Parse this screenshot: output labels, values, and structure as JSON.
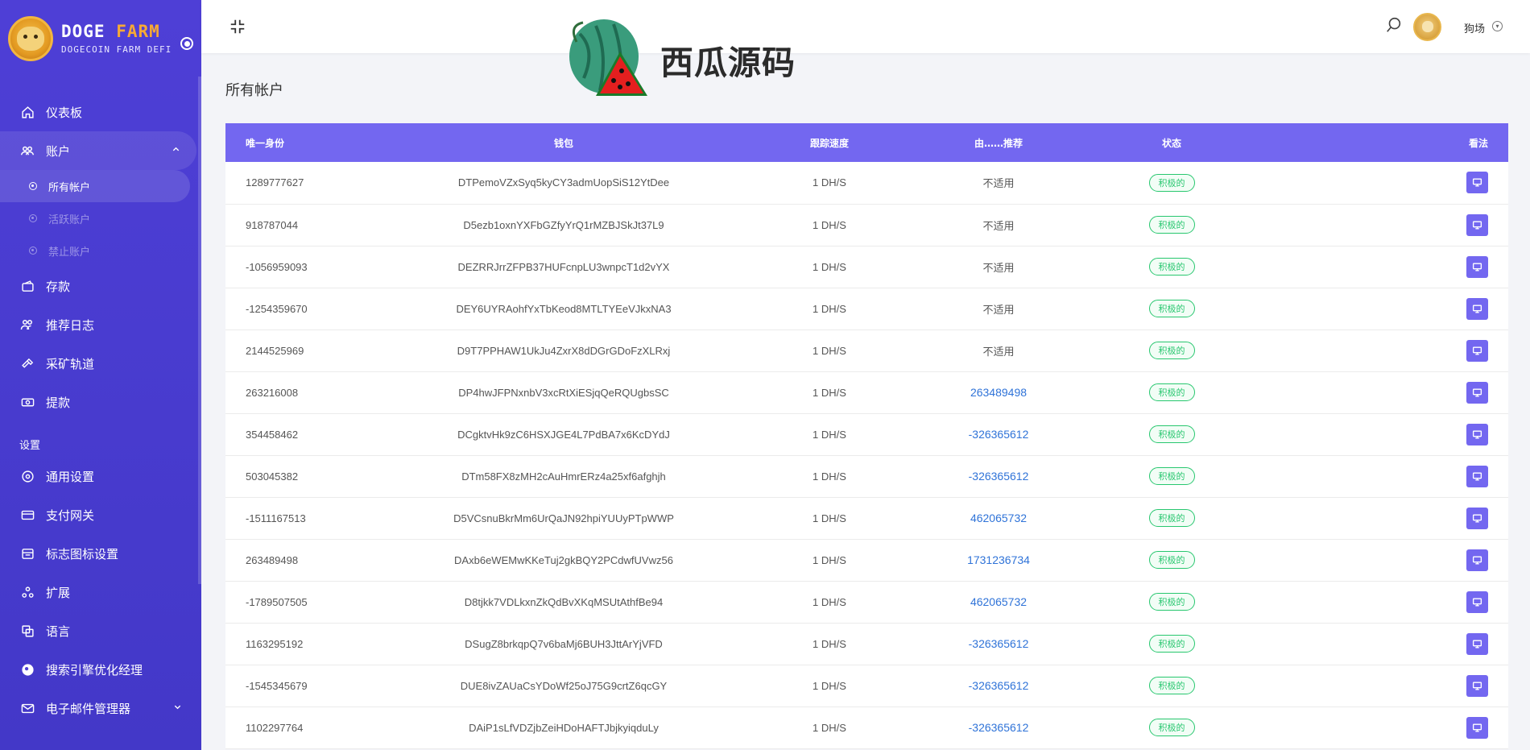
{
  "brand": {
    "title_part1": "DOGE",
    "title_part2": "FARM",
    "subtitle": "DOGECOIN FARM DEFI"
  },
  "sidebar": {
    "items": [
      {
        "label": "仪表板",
        "icon": "home-icon"
      },
      {
        "label": "账户",
        "icon": "users-icon"
      },
      {
        "label": "存款",
        "icon": "wallet-icon"
      },
      {
        "label": "推荐日志",
        "icon": "users-pair-icon"
      },
      {
        "label": "采矿轨道",
        "icon": "hammer-icon"
      },
      {
        "label": "提款",
        "icon": "money-icon"
      }
    ],
    "sub_items": [
      {
        "label": "所有帐户"
      },
      {
        "label": "活跃账户"
      },
      {
        "label": "禁止账户"
      }
    ],
    "section_label": "设置",
    "settings_items": [
      {
        "label": "通用设置",
        "icon": "gear-circle-icon"
      },
      {
        "label": "支付网关",
        "icon": "card-icon"
      },
      {
        "label": "标志图标设置",
        "icon": "image-icon"
      },
      {
        "label": "扩展",
        "icon": "puzzle-icon"
      },
      {
        "label": "语言",
        "icon": "language-icon"
      },
      {
        "label": "搜索引擎优化经理",
        "icon": "globe-icon"
      },
      {
        "label": "电子邮件管理器",
        "icon": "mail-icon"
      }
    ]
  },
  "header": {
    "watermark_text": "西瓜源码",
    "user_name": "狗场"
  },
  "page": {
    "title": "所有帐户"
  },
  "table": {
    "headers": {
      "id": "唯一身份",
      "wallet": "钱包",
      "speed": "跟踪速度",
      "referred_by": "由……推荐",
      "status": "状态",
      "view": "看法"
    },
    "rows": [
      {
        "id": "1289777627",
        "wallet": "DTPemoVZxSyq5kyCY3admUopSiS12YtDee",
        "speed": "1 DH/S",
        "ref": "不适用",
        "ref_link": false,
        "status": "积极的"
      },
      {
        "id": "918787044",
        "wallet": "D5ezb1oxnYXFbGZfyYrQ1rMZBJSkJt37L9",
        "speed": "1 DH/S",
        "ref": "不适用",
        "ref_link": false,
        "status": "积极的"
      },
      {
        "id": "-1056959093",
        "wallet": "DEZRRJrrZFPB37HUFcnpLU3wnpcT1d2vYX",
        "speed": "1 DH/S",
        "ref": "不适用",
        "ref_link": false,
        "status": "积极的"
      },
      {
        "id": "-1254359670",
        "wallet": "DEY6UYRAohfYxTbKeod8MTLTYEeVJkxNA3",
        "speed": "1 DH/S",
        "ref": "不适用",
        "ref_link": false,
        "status": "积极的"
      },
      {
        "id": "2144525969",
        "wallet": "D9T7PPHAW1UkJu4ZxrX8dDGrGDoFzXLRxj",
        "speed": "1 DH/S",
        "ref": "不适用",
        "ref_link": false,
        "status": "积极的"
      },
      {
        "id": "263216008",
        "wallet": "DP4hwJFPNxnbV3xcRtXiESjqQeRQUgbsSC",
        "speed": "1 DH/S",
        "ref": "263489498",
        "ref_link": true,
        "status": "积极的"
      },
      {
        "id": "354458462",
        "wallet": "DCgktvHk9zC6HSXJGE4L7PdBA7x6KcDYdJ",
        "speed": "1 DH/S",
        "ref": "-326365612",
        "ref_link": true,
        "status": "积极的"
      },
      {
        "id": "503045382",
        "wallet": "DTm58FX8zMH2cAuHmrERz4a25xf6afghjh",
        "speed": "1 DH/S",
        "ref": "-326365612",
        "ref_link": true,
        "status": "积极的"
      },
      {
        "id": "-1511167513",
        "wallet": "D5VCsnuBkrMm6UrQaJN92hpiYUUyPTpWWP",
        "speed": "1 DH/S",
        "ref": "462065732",
        "ref_link": true,
        "status": "积极的"
      },
      {
        "id": "263489498",
        "wallet": "DAxb6eWEMwKKeTuj2gkBQY2PCdwfUVwz56",
        "speed": "1 DH/S",
        "ref": "1731236734",
        "ref_link": true,
        "status": "积极的"
      },
      {
        "id": "-1789507505",
        "wallet": "D8tjkk7VDLkxnZkQdBvXKqMSUtAthfBe94",
        "speed": "1 DH/S",
        "ref": "462065732",
        "ref_link": true,
        "status": "积极的"
      },
      {
        "id": "1163295192",
        "wallet": "DSugZ8brkqpQ7v6baMj6BUH3JttArYjVFD",
        "speed": "1 DH/S",
        "ref": "-326365612",
        "ref_link": true,
        "status": "积极的"
      },
      {
        "id": "-1545345679",
        "wallet": "DUE8ivZAUaCsYDoWf25oJ75G9crtZ6qcGY",
        "speed": "1 DH/S",
        "ref": "-326365612",
        "ref_link": true,
        "status": "积极的"
      },
      {
        "id": "1102297764",
        "wallet": "DAiP1sLfVDZjbZeiHDoHAFTJbjkyiqduLy",
        "speed": "1 DH/S",
        "ref": "-326365612",
        "ref_link": true,
        "status": "积极的"
      }
    ]
  },
  "colors": {
    "sidebar": "#4e3fd6",
    "table_header": "#7367f0",
    "badge_green": "#28c76f",
    "link_blue": "#2f73d8"
  }
}
